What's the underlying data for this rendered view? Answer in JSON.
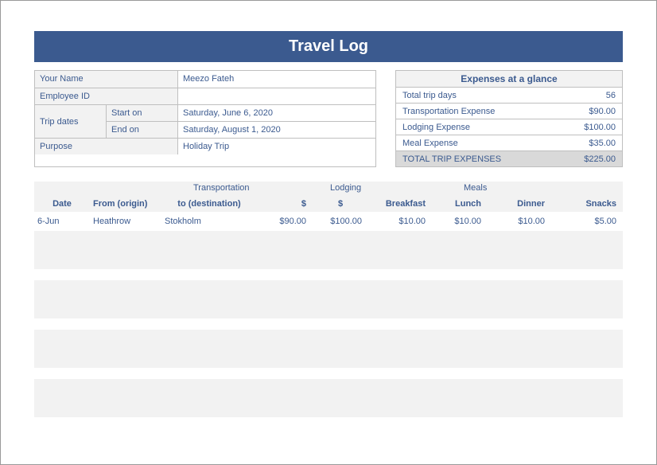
{
  "title": "Travel Log",
  "info": {
    "name_label": "Your Name",
    "name_value": "Meezo Fateh",
    "emp_label": "Employee ID",
    "emp_value": "",
    "tripdates_label": "Trip dates",
    "start_label": "Start on",
    "start_value": "Saturday, June 6, 2020",
    "end_label": "End on",
    "end_value": "Saturday, August 1, 2020",
    "purpose_label": "Purpose",
    "purpose_value": "Holiday Trip"
  },
  "glance": {
    "title": "Expenses at a glance",
    "rows": [
      {
        "label": "Total trip days",
        "value": "56"
      },
      {
        "label": "Transportation Expense",
        "value": "$90.00"
      },
      {
        "label": "Lodging Expense",
        "value": "$100.00"
      },
      {
        "label": "Meal Expense",
        "value": "$35.00"
      }
    ],
    "total_label": "TOTAL TRIP EXPENSES",
    "total_value": "$225.00"
  },
  "log_headers": {
    "group_transport": "Transportation",
    "group_lodging": "Lodging",
    "group_meals": "Meals",
    "date": "Date",
    "from": "From (origin)",
    "to": "to (destination)",
    "cost": "$",
    "lodge": "$",
    "breakfast": "Breakfast",
    "lunch": "Lunch",
    "dinner": "Dinner",
    "snacks": "Snacks"
  },
  "log_rows": [
    {
      "date": "6-Jun",
      "from": "Heathrow",
      "to": "Stokholm",
      "tcost": "$90.00",
      "lodge": "$100.00",
      "bfast": "$10.00",
      "lunch": "$10.00",
      "dinner": "$10.00",
      "snacks": "$5.00"
    }
  ]
}
